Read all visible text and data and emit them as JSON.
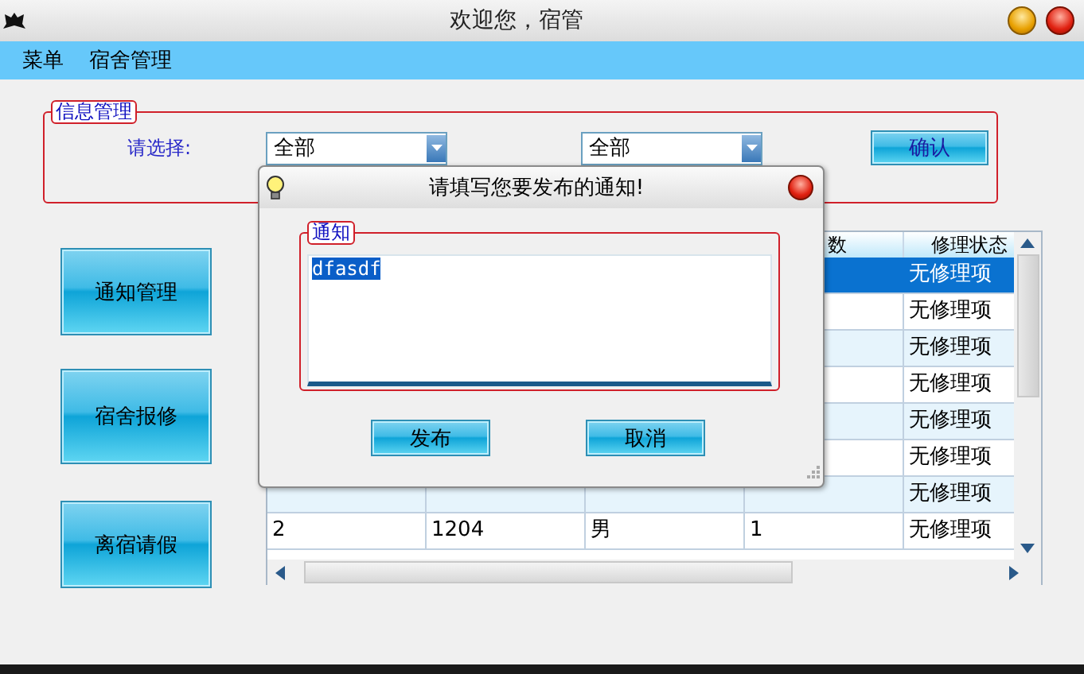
{
  "window": {
    "title": "欢迎您，宿管"
  },
  "menu": [
    {
      "label": "菜单"
    },
    {
      "label": "宿舍管理"
    }
  ],
  "info_group": {
    "title": "信息管理",
    "prompt": "请选择:",
    "filters": [
      {
        "value": "全部"
      },
      {
        "value": "全部"
      }
    ],
    "confirm": "确认"
  },
  "nav_buttons": [
    {
      "label": "通知管理"
    },
    {
      "label": "宿舍报修"
    },
    {
      "label": "离宿请假"
    }
  ],
  "table": {
    "columns": [
      "数",
      "修理状态"
    ],
    "rows": [
      {
        "selected": true,
        "cells": [],
        "status": "无修理项"
      },
      {
        "selected": false,
        "cells": [],
        "status": "无修理项"
      },
      {
        "selected": false,
        "cells": [],
        "status": "无修理项"
      },
      {
        "selected": false,
        "cells": [],
        "status": "无修理项"
      },
      {
        "selected": false,
        "cells": [],
        "status": "无修理项"
      },
      {
        "selected": false,
        "cells": [],
        "status": "无修理项"
      },
      {
        "selected": false,
        "cells": [],
        "status": "无修理项"
      },
      {
        "selected": false,
        "cells": [
          "2",
          "1204",
          "男",
          "1"
        ],
        "status": "无修理项"
      }
    ]
  },
  "dialog": {
    "title": "请填写您要发布的通知!",
    "group": "通知",
    "field": {
      "value": "dfasdf",
      "selected": true
    },
    "buttons": [
      "发布",
      "取消"
    ]
  }
}
